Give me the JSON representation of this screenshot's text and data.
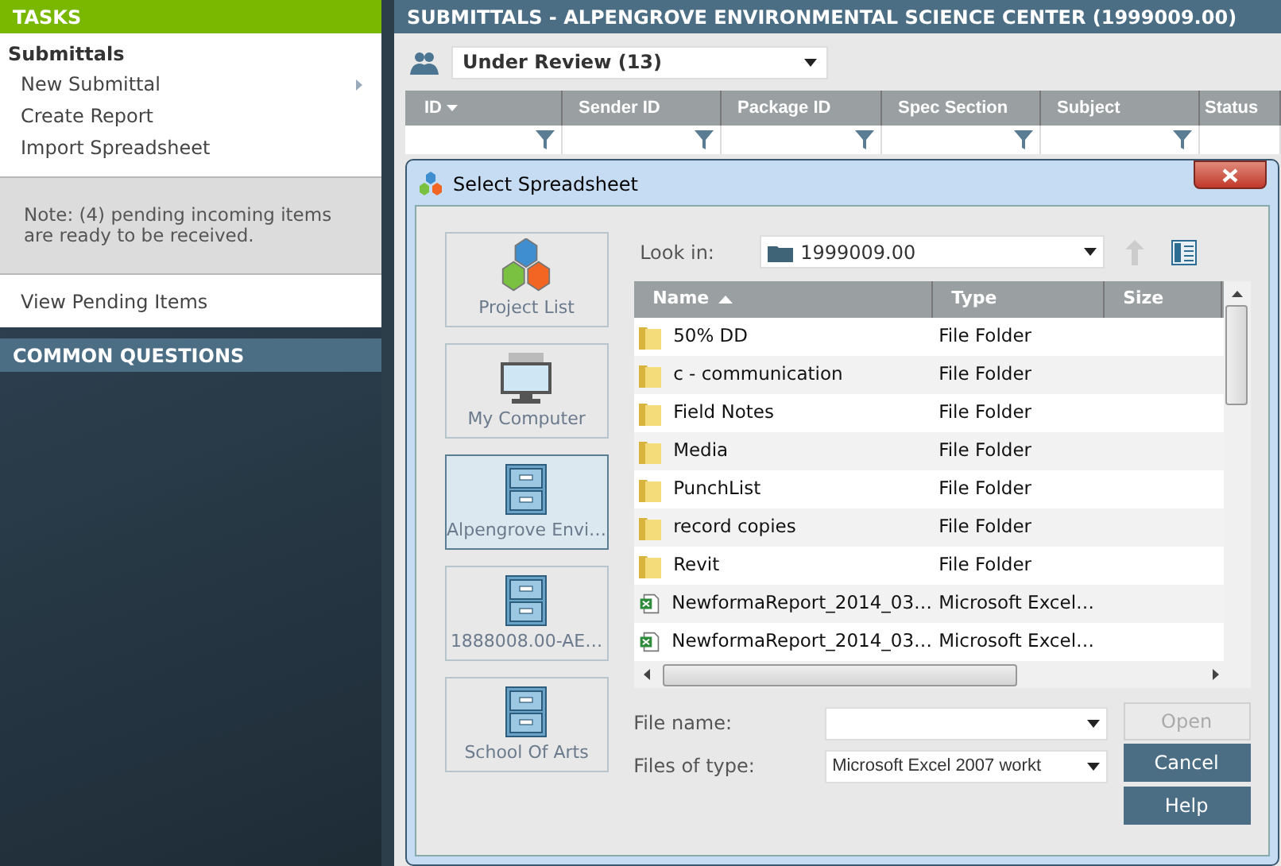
{
  "sidebar": {
    "header": "TASKS",
    "section_title": "Submittals",
    "items": [
      {
        "label": "New Submittal",
        "has_submenu": true
      },
      {
        "label": "Create Report",
        "has_submenu": false
      },
      {
        "label": "Import Spreadsheet",
        "has_submenu": false
      }
    ],
    "note": "Note: (4) pending incoming items are ready to be received.",
    "pending_link": "View Pending Items",
    "common_questions": "COMMON QUESTIONS"
  },
  "main": {
    "title": "SUBMITTALS - ALPENGROVE ENVIRONMENTAL SCIENCE CENTER (1999009.00)",
    "filter": {
      "value": "Under Review (13)"
    },
    "columns": [
      {
        "label": "ID",
        "sorted": true
      },
      {
        "label": "Sender ID",
        "sorted": false
      },
      {
        "label": "Package ID",
        "sorted": false
      },
      {
        "label": "Spec Section",
        "sorted": false
      },
      {
        "label": "Subject",
        "sorted": false
      },
      {
        "label": "Status",
        "sorted": false
      }
    ]
  },
  "dialog": {
    "title": "Select Spreadsheet",
    "places": [
      {
        "label": "Project List",
        "kind": "project",
        "selected": false
      },
      {
        "label": "My Computer",
        "kind": "computer",
        "selected": false
      },
      {
        "label": "Alpengrove Envi…",
        "kind": "cabinet",
        "selected": true
      },
      {
        "label": "1888008.00-AE…",
        "kind": "cabinet",
        "selected": false
      },
      {
        "label": "School Of Arts",
        "kind": "cabinet",
        "selected": false
      }
    ],
    "look_in": {
      "label": "Look in:",
      "value": "1999009.00"
    },
    "columns": [
      "Name",
      "Type",
      "Size"
    ],
    "files": [
      {
        "name": "50% DD",
        "type": "File Folder",
        "kind": "folder"
      },
      {
        "name": "c - communication",
        "type": "File Folder",
        "kind": "folder"
      },
      {
        "name": "Field Notes",
        "type": "File Folder",
        "kind": "folder"
      },
      {
        "name": "Media",
        "type": "File Folder",
        "kind": "folder"
      },
      {
        "name": "PunchList",
        "type": "File Folder",
        "kind": "folder"
      },
      {
        "name": "record copies",
        "type": "File Folder",
        "kind": "folder"
      },
      {
        "name": "Revit",
        "type": "File Folder",
        "kind": "folder"
      },
      {
        "name": "NewformaReport_2014_03…",
        "type": "Microsoft Excel…",
        "kind": "excel"
      },
      {
        "name": "NewformaReport_2014_03…",
        "type": "Microsoft Excel…",
        "kind": "excel"
      }
    ],
    "file_name": {
      "label": "File name:"
    },
    "file_type": {
      "label": "Files of type:",
      "value": "Microsoft Excel 2007 workt"
    },
    "buttons": [
      {
        "label": "Open",
        "disabled": true
      },
      {
        "label": "Cancel",
        "disabled": false
      },
      {
        "label": "Help",
        "disabled": false
      }
    ]
  }
}
